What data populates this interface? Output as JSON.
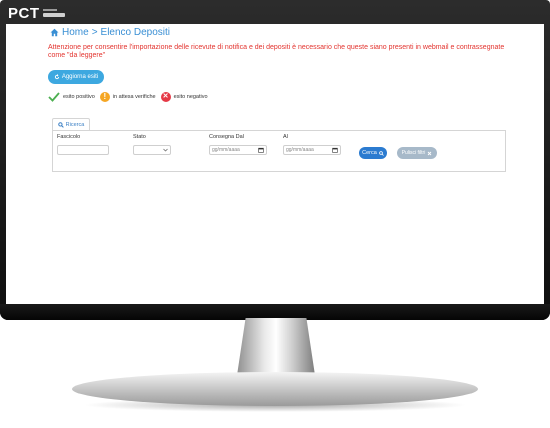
{
  "app": {
    "logo_text": "PCT"
  },
  "breadcrumb": {
    "home": "Home",
    "separator": ">",
    "current": "Elenco Depositi"
  },
  "warning": {
    "text": "Attenzione per consentire l'importazione delle ricevute di notifica e dei depositi è necessario che queste siano presenti in webmail e contrassegnate come \"da leggere\""
  },
  "toolbar": {
    "update_label": "Aggiorna esiti"
  },
  "legend": {
    "positive": {
      "label": "esito positivo",
      "color": "#4caf50"
    },
    "pending": {
      "label": "in attesa verifiche",
      "color": "#f5a623"
    },
    "negative": {
      "label": "esito negativo",
      "color": "#e53946"
    }
  },
  "search": {
    "tab_label": "Ricerca",
    "fascicolo_label": "Fascicolo",
    "stato_label": "Stato",
    "consegna_dal_label": "Consegna Dal",
    "al_label": "Al",
    "date_placeholder_dal": "gg/mm/aaaa",
    "date_placeholder_al": "gg/mm/aaaa",
    "cerca_label": "Cerca",
    "pulisci_label": "Pulisci filtri"
  },
  "colors": {
    "accent": "#3da8e0",
    "primary": "#2b7bd0",
    "danger": "#e3342f"
  }
}
